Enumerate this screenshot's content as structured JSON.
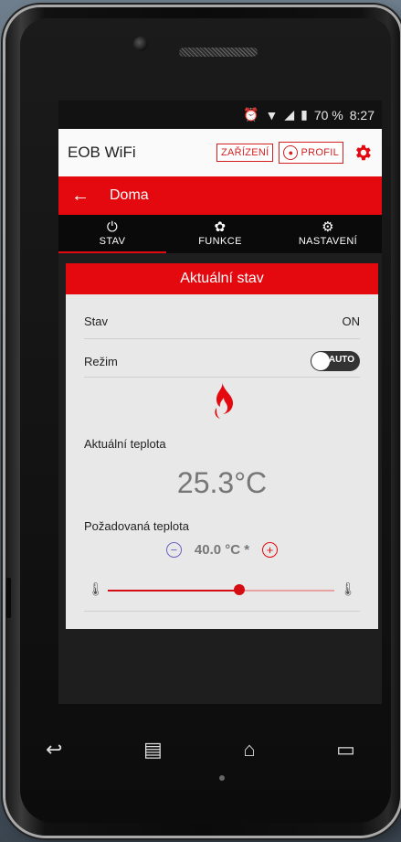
{
  "status_bar": {
    "alarm_icon": "alarm-clock-icon",
    "wifi_icon": "wifi-icon",
    "signal_icon": "cell-signal-icon",
    "battery_icon": "battery-icon",
    "battery": "70 %",
    "time": "8:27"
  },
  "app_bar": {
    "title": "EOB WiFi",
    "devices_label": "ZAŘÍZENÍ",
    "profile_label": "PROFIL",
    "settings_icon": "gear-icon"
  },
  "location_bar": {
    "back_icon": "arrow-left-icon",
    "title": "Doma"
  },
  "tabs": [
    {
      "label": "STAV",
      "icon": "power-icon",
      "active": true
    },
    {
      "label": "FUNKCE",
      "icon": "fan-icon",
      "active": false
    },
    {
      "label": "NASTAVENÍ",
      "icon": "gear-icon",
      "active": false
    }
  ],
  "card": {
    "header": "Aktuální stav",
    "stav_label": "Stav",
    "stav_value": "ON",
    "rezim_label": "Režim",
    "rezim_toggle": "AUTO",
    "flame_icon": "flame-icon",
    "current_temp_label": "Aktuální teplota",
    "current_temp": "25.3°C",
    "target_temp_label": "Požadovaná teplota",
    "target_temp": "40.0 °C *",
    "slider_fraction": 0.58
  },
  "colors": {
    "accent_red": "#e4090e",
    "minus_purple": "#6b63c4"
  }
}
